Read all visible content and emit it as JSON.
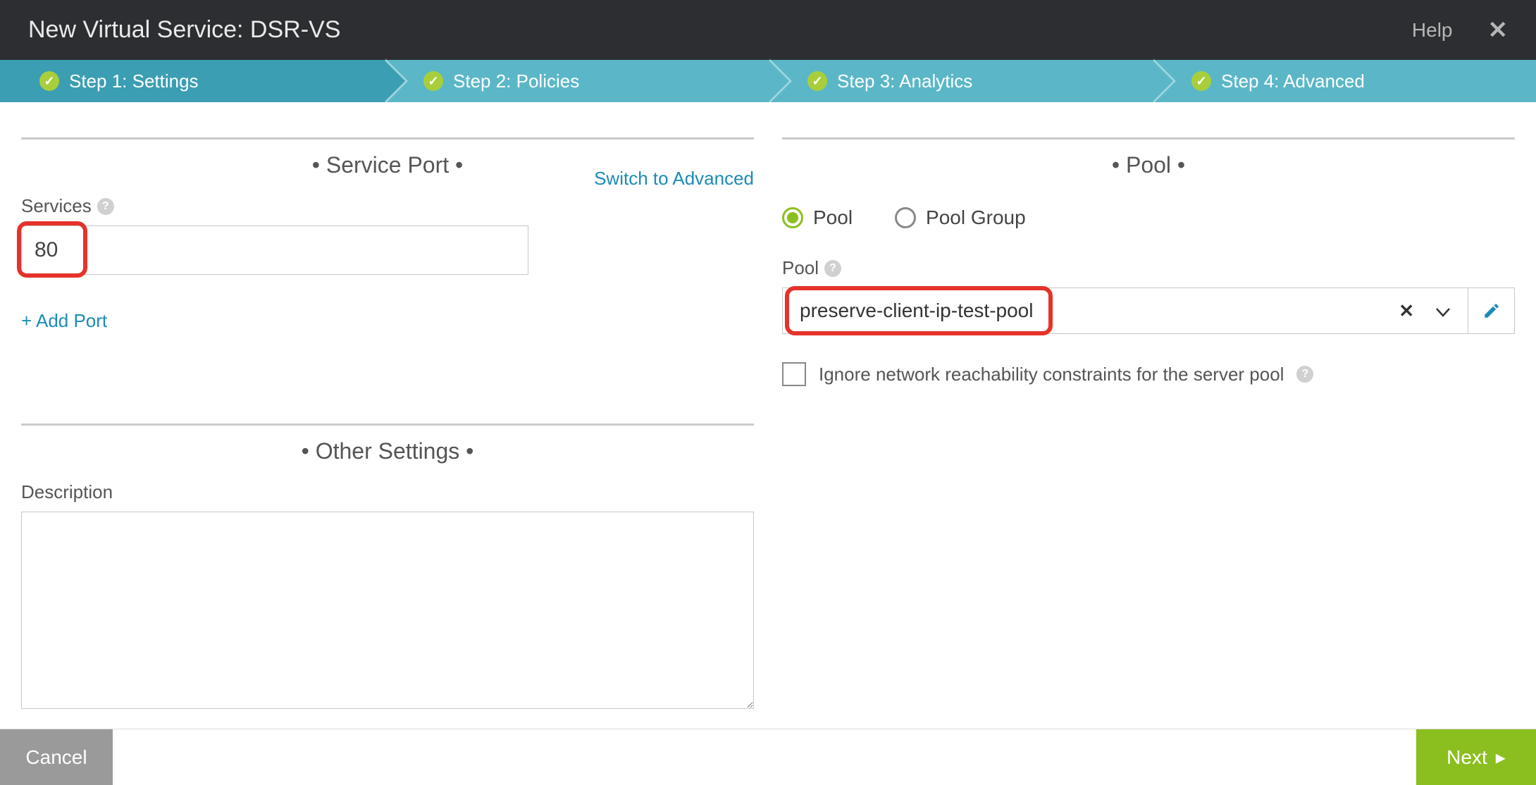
{
  "header": {
    "title": "New Virtual Service: DSR-VS",
    "help_label": "Help"
  },
  "stepper": [
    {
      "label": "Step 1: Settings",
      "active": true
    },
    {
      "label": "Step 2: Policies",
      "active": false
    },
    {
      "label": "Step 3: Analytics",
      "active": false
    },
    {
      "label": "Step 4: Advanced",
      "active": false
    }
  ],
  "service_port": {
    "section_title": "• Service Port •",
    "switch_link": "Switch to Advanced",
    "services_label": "Services",
    "services_value": "80",
    "add_port_label": "+ Add Port"
  },
  "other_settings": {
    "section_title": "• Other Settings •",
    "description_label": "Description",
    "description_value": ""
  },
  "pool": {
    "section_title": "• Pool •",
    "radio_pool": "Pool",
    "radio_pool_group": "Pool Group",
    "selected_radio": "Pool",
    "pool_label": "Pool",
    "pool_value": "preserve-client-ip-test-pool",
    "ignore_label": "Ignore network reachability constraints for the server pool",
    "ignore_checked": false
  },
  "footer": {
    "cancel_label": "Cancel",
    "next_label": "Next"
  }
}
